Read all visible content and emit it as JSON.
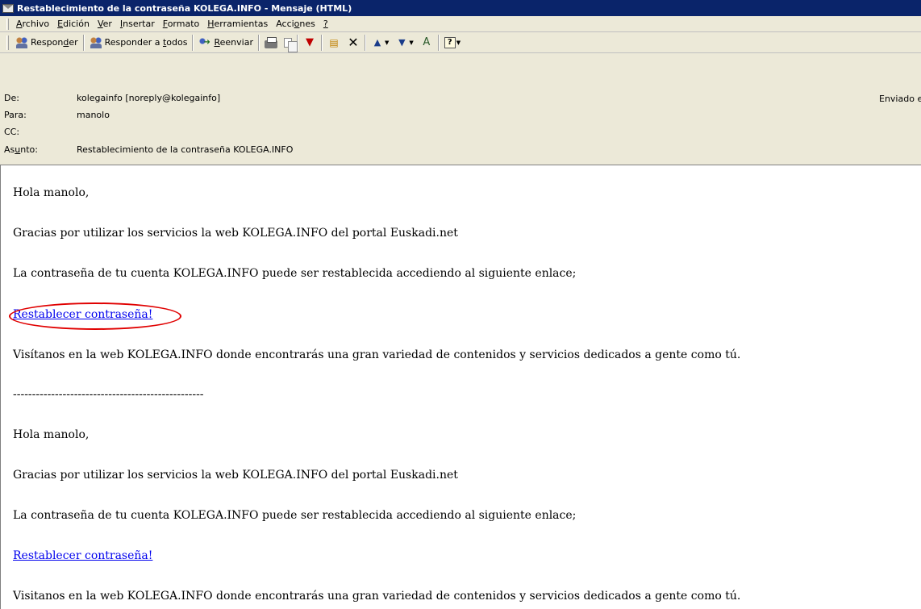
{
  "window": {
    "title": "Restablecimiento de la contraseña KOLEGA.INFO - Mensaje (HTML)"
  },
  "menu": [
    {
      "pre": "",
      "u": "A",
      "post": "rchivo"
    },
    {
      "pre": "",
      "u": "E",
      "post": "dición"
    },
    {
      "pre": "",
      "u": "V",
      "post": "er"
    },
    {
      "pre": "",
      "u": "I",
      "post": "nsertar"
    },
    {
      "pre": "",
      "u": "F",
      "post": "ormato"
    },
    {
      "pre": "",
      "u": "H",
      "post": "erramientas"
    },
    {
      "pre": "Acci",
      "u": "o",
      "post": "nes"
    },
    {
      "pre": "",
      "u": "?",
      "post": ""
    }
  ],
  "toolbar": {
    "reply": {
      "pre": "Respon",
      "u": "d",
      "post": "er"
    },
    "reply_all": {
      "pre": "Responder a ",
      "u": "t",
      "post": "odos"
    },
    "forward": {
      "pre": "",
      "u": "R",
      "post": "eenviar"
    }
  },
  "headers": {
    "from_label": "De:",
    "from_value": "kolegainfo [noreply@kolegainfo]",
    "to_label": "Para:",
    "to_value": "manolo",
    "cc_label": "CC:",
    "cc_value": "",
    "subject_label_pre": "As",
    "subject_label_u": "u",
    "subject_label_post": "nto:",
    "subject_value": "Restablecimiento de la contraseña KOLEGA.INFO",
    "sent_label": "Enviado el:"
  },
  "body": {
    "greeting": "Hola manolo,",
    "thanks": "Gracias por utilizar los servicios la web KOLEGA.INFO del portal Euskadi.net",
    "reset_info": "La contraseña de tu cuenta KOLEGA.INFO puede ser restablecida accediendo al siguiente enlace;",
    "reset_link": "Restablecer contraseña!",
    "visit": "Visítanos en la web KOLEGA.INFO donde encontrarás una gran variedad de contenidos y servicios dedicados a gente como tú.",
    "separator": "--------------------------------------------------",
    "greeting_2": "Hola manolo,",
    "thanks_2": "Gracias por utilizar los servicios la web KOLEGA.INFO del portal Euskadi.net",
    "reset_info_2": "La contraseña de tu cuenta KOLEGA.INFO puede ser restablecida accediendo al siguiente enlace;",
    "reset_link_2": "Restablecer contraseña!",
    "visit_2": "Visitanos en la web KOLEGA.INFO donde encontrarás una gran variedad de contenidos y servicios dedicados a gente como tú."
  },
  "annotation_color": "#e00000",
  "link_color": "#0000ee"
}
